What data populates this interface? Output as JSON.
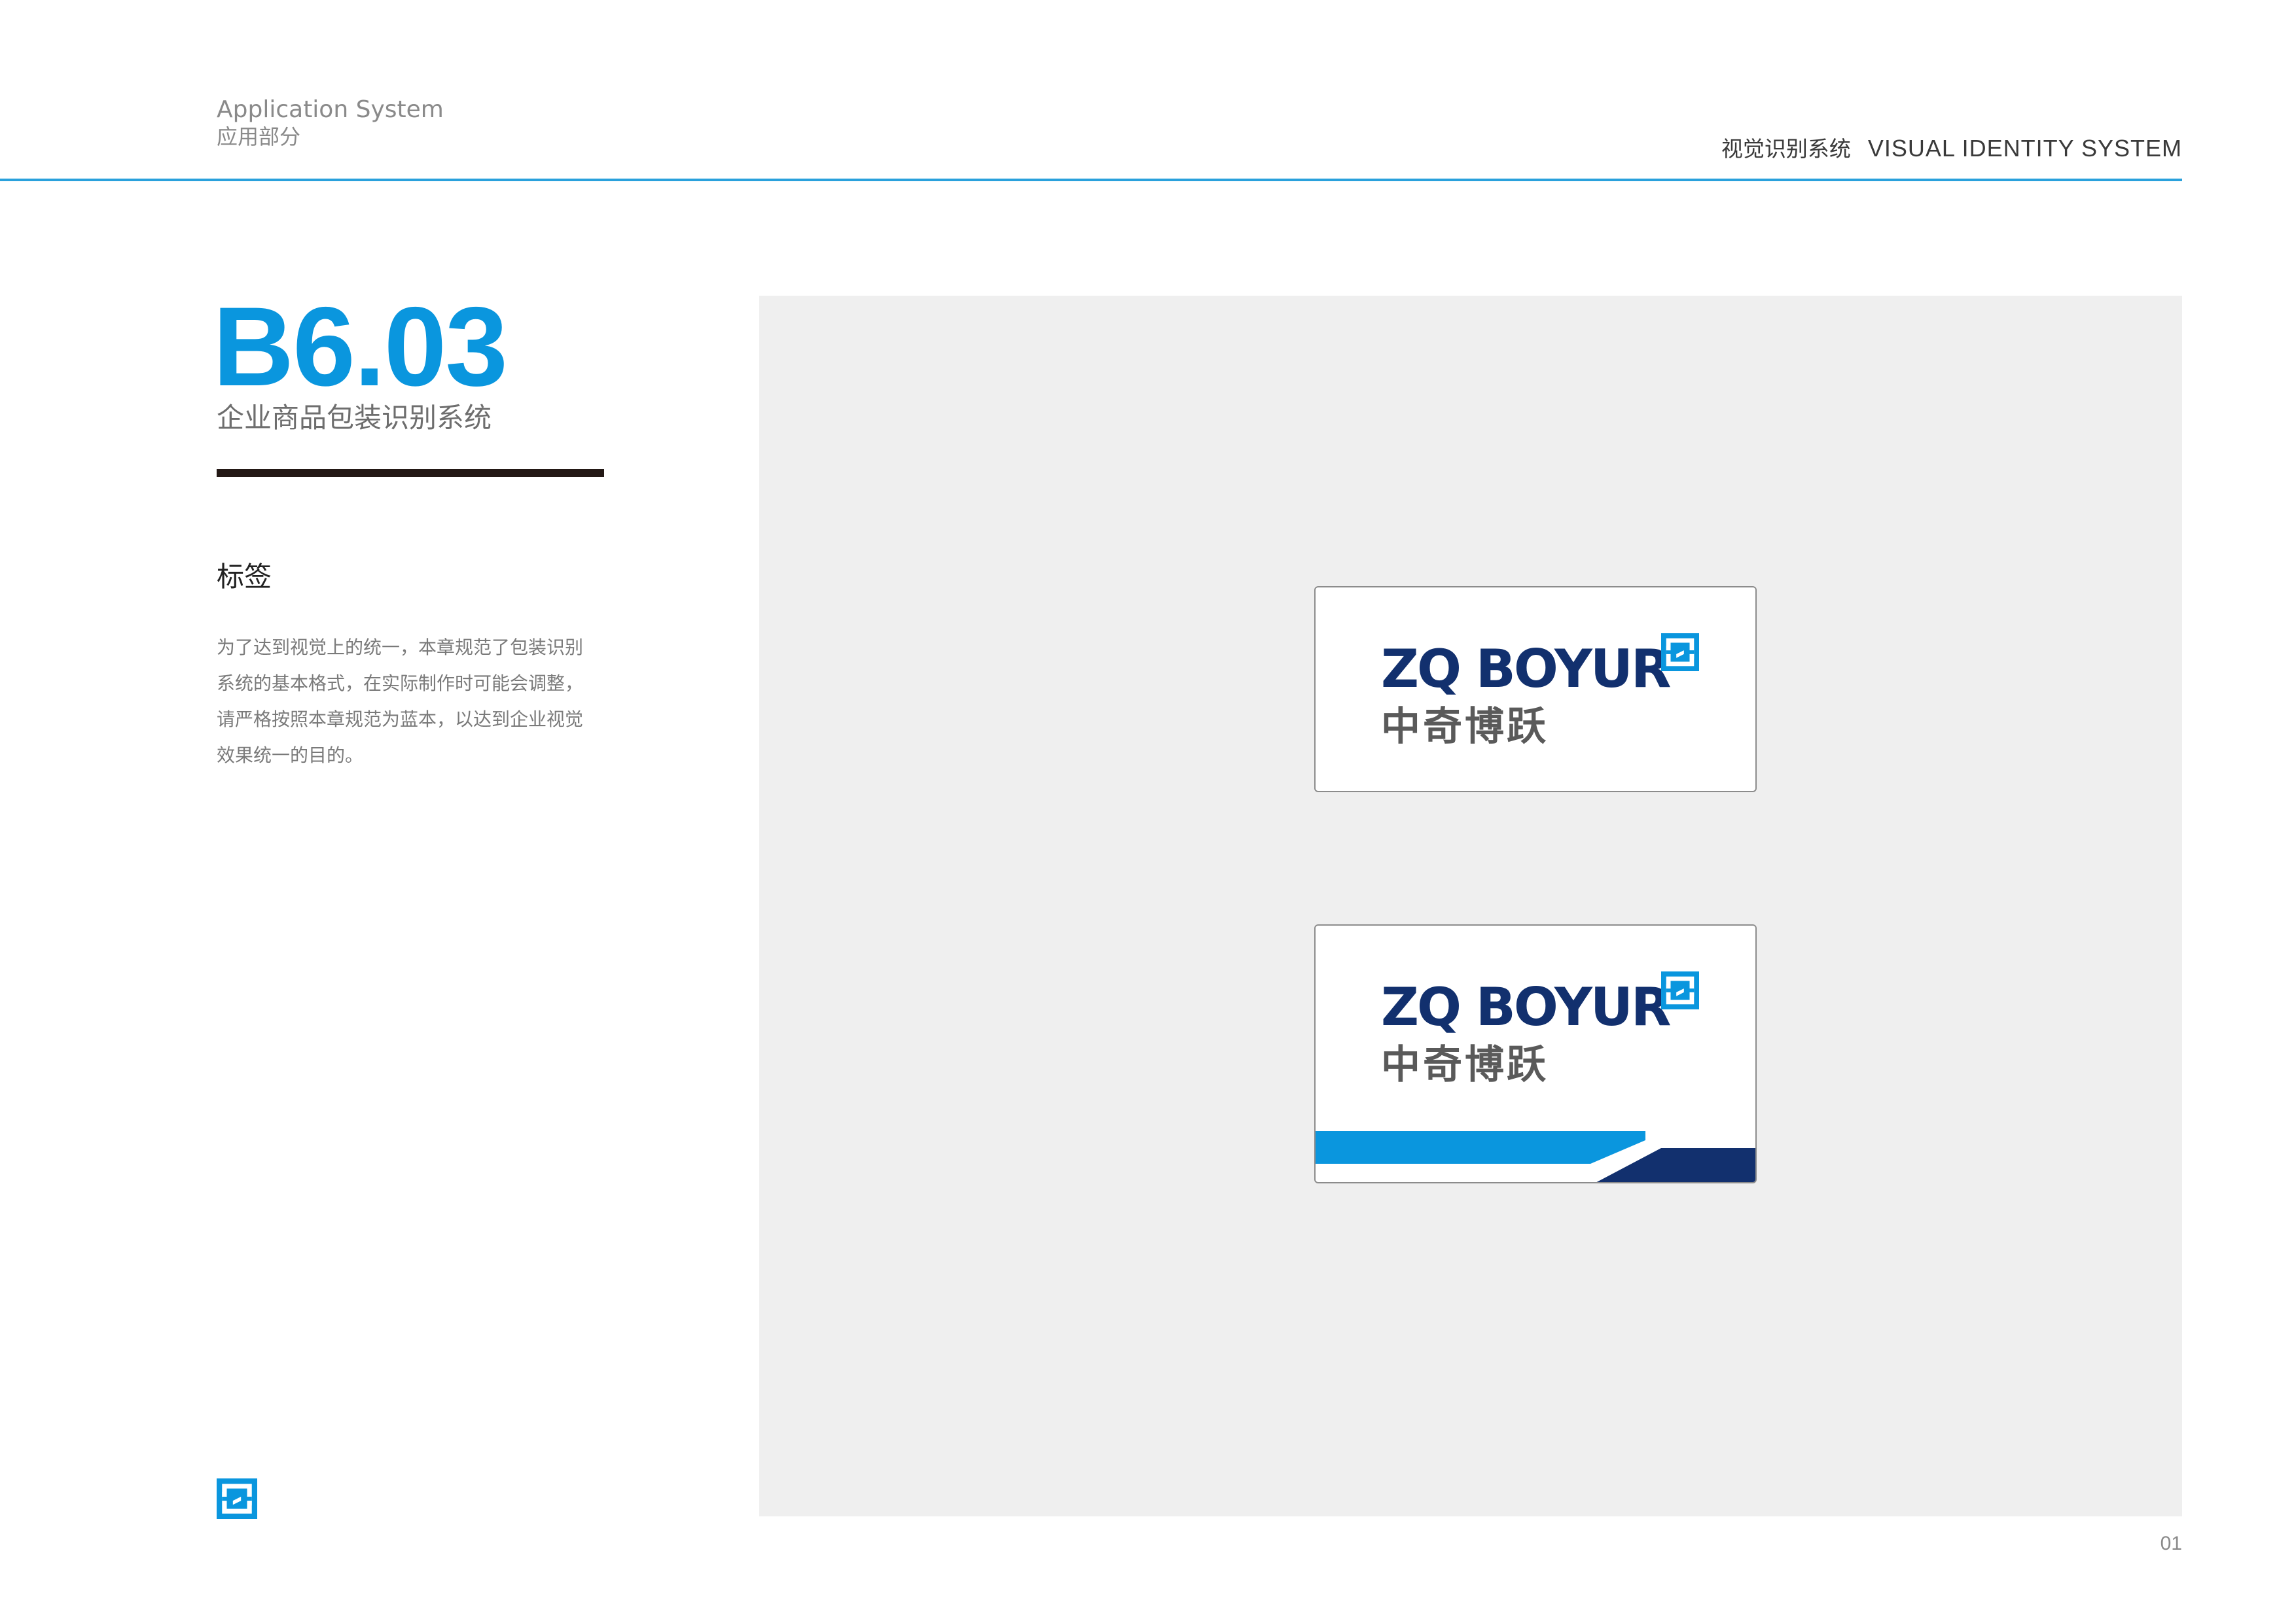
{
  "header": {
    "section_en": "Application System",
    "section_cn": "应用部分",
    "system_cn": "视觉识别系统",
    "system_en": "VISUAL IDENTITY SYSTEM"
  },
  "section": {
    "code": "B6.03",
    "title": "企业商品包装识别系统",
    "subtitle": "标签",
    "description_lines": [
      "为了达到视觉上的统一，本章规范了包装识别",
      "系统的基本格式，在实际制作时可能会调整，",
      "请严格按照本章规范为蓝本，以达到企业视觉",
      "效果统一的目的。"
    ]
  },
  "labels": [
    {
      "logo_en": "ZQ BOYUR",
      "logo_cn": "中奇博跃",
      "style": "plain"
    },
    {
      "logo_en": "ZQ BOYUR",
      "logo_cn": "中奇博跃",
      "style": "stripes"
    }
  ],
  "footer": {
    "page_number": "01"
  },
  "colors": {
    "accent_blue": "#0a96de",
    "rule_blue": "#2aa1dc",
    "navy": "#12306e",
    "dark_rule": "#231815",
    "panel_gray": "#efefef"
  },
  "icons": {
    "brand_mark": "zq-brand-mark-icon"
  }
}
